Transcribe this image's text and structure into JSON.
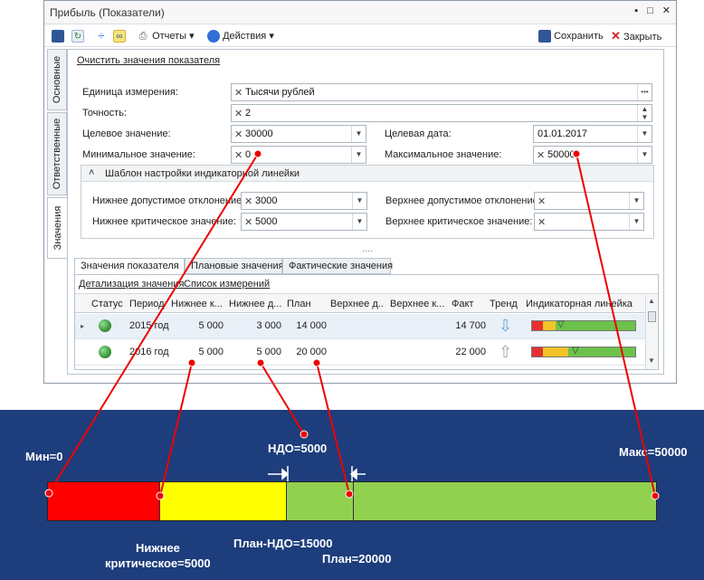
{
  "window": {
    "title": "Прибыль (Показатели)",
    "controls": [
      "▪",
      "□",
      "✕"
    ]
  },
  "toolbar": {
    "reports_label": "Отчеты ▾",
    "actions_label": "Действия ▾",
    "save_label": "Сохранить",
    "close_label": "Закрыть"
  },
  "side_tabs": [
    "Основные",
    "Ответственные",
    "Значения"
  ],
  "panel": {
    "clear_link": "Очистить значения показателя",
    "unit_label": "Единица измерения:",
    "unit_value": "Тысячи рублей",
    "precision_label": "Точность:",
    "precision_value": "2",
    "target_label": "Целевое значение:",
    "target_value": "30000",
    "target_date_label": "Целевая дата:",
    "target_date_value": "01.01.2017",
    "min_label": "Минимальное значение:",
    "min_value": "0",
    "max_label": "Максимальное значение:",
    "max_value": "50000",
    "group_title": "Шаблон настройки индикаторной линейки",
    "lower_dev_label": "Нижнее допустимое отклонение:",
    "lower_dev_value": "3000",
    "upper_dev_label": "Верхнее допустимое отклонение:",
    "upper_dev_value": "",
    "lower_crit_label": "Нижнее критическое значение:",
    "lower_crit_value": "5000",
    "upper_crit_label": "Верхнее критическое значение:",
    "upper_crit_value": "",
    "dots": "....",
    "tabs": [
      "Значения показателя",
      "Плановые значения",
      "Фактические значения"
    ],
    "sublinks": [
      "Детализация значения",
      "Список измерений"
    ]
  },
  "grid": {
    "headers": [
      "Статус",
      "Период",
      "Нижнее к...",
      "Нижнее д...",
      "План",
      "Верхнее д...",
      "Верхнее к...",
      "Факт",
      "Тренд",
      "Индикаторная линейка"
    ],
    "rows": [
      {
        "period": "2015 год",
        "lower_crit": "5 000",
        "lower_dev": "3 000",
        "plan": "14 000",
        "upper_dev": "",
        "upper_crit": "",
        "fact": "14 700",
        "trend": "⇩"
      },
      {
        "period": "2016 год",
        "lower_crit": "5 000",
        "lower_dev": "5 000",
        "plan": "20 000",
        "upper_dev": "",
        "upper_crit": "",
        "fact": "22 000",
        "trend": "⇧"
      }
    ]
  },
  "diagram": {
    "min_label": "Мин=0",
    "max_label": "Макс=50000",
    "ndo_label": "НДО=5000",
    "lower_crit_label_1": "Нижнее",
    "lower_crit_label_2": "критическое=5000",
    "plan_ndo_label": "План-НДО=15000",
    "plan_label": "План=20000",
    "colors": {
      "red": "#ff0000",
      "yellow": "#ffff00",
      "green": "#92d050",
      "background": "#1d3d7c"
    }
  }
}
